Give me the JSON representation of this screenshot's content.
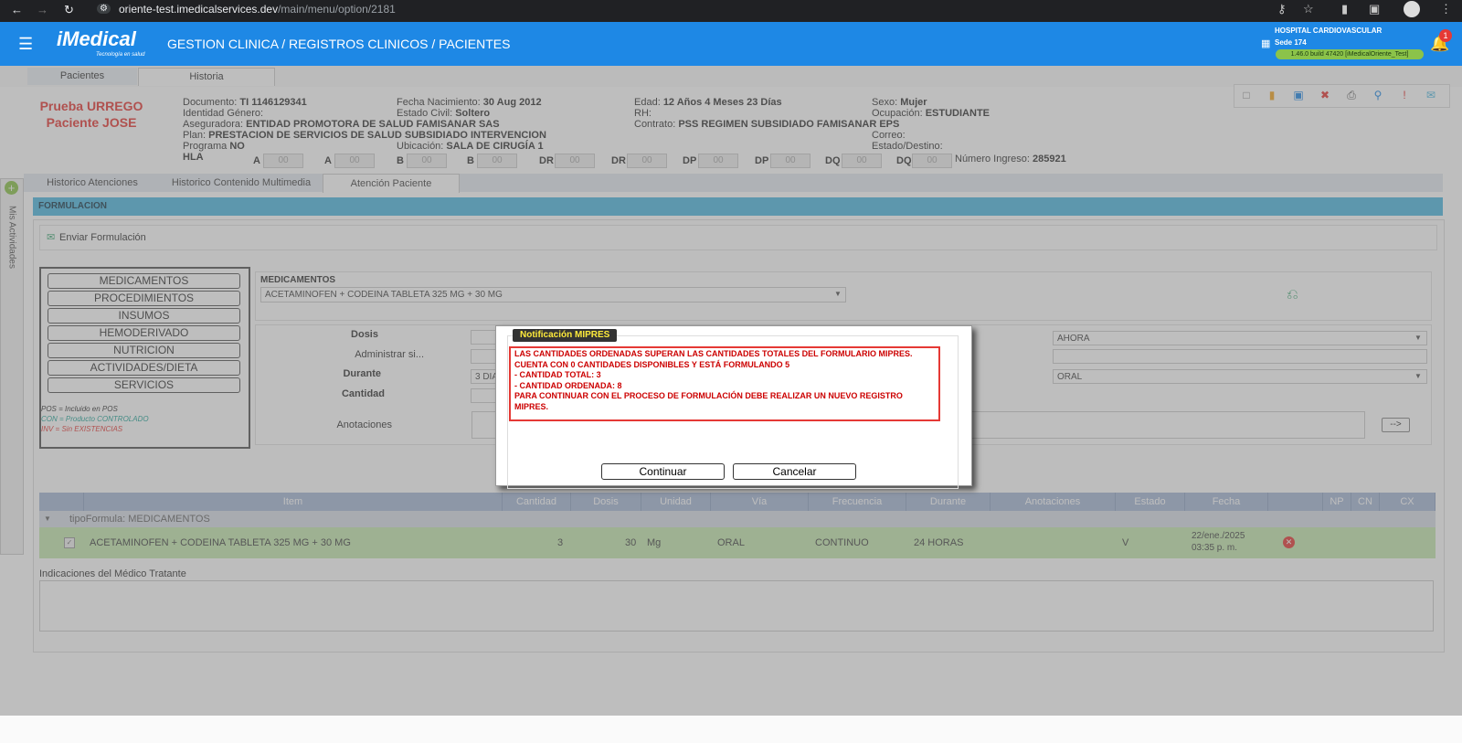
{
  "browser": {
    "url_host": "oriente-test.imedicalservices.dev",
    "url_path": "/main/menu/option/2181"
  },
  "header": {
    "logo": "iMedical",
    "logo_tagline": "Tecnología en salud",
    "breadcrumb": "GESTION CLINICA  /  REGISTROS CLINICOS  /  PACIENTES",
    "hospital": "HOSPITAL CARDIOVASCULAR",
    "sede": "Sede 174",
    "build": "1.46.0 build 47420 [iMedicalOriente_Test]",
    "notifications": "1"
  },
  "main_tabs": [
    "Pacientes",
    "Historia"
  ],
  "patient": {
    "name": "Prueba URREGO Paciente JOSE",
    "documento_label": "Documento:",
    "documento": "TI 1146129341",
    "fecha_nac_label": "Fecha Nacimiento:",
    "fecha_nac": "30 Aug 2012",
    "edad_label": "Edad:",
    "edad": "12 Años 4 Meses 23 Días",
    "sexo_label": "Sexo:",
    "sexo": "Mujer",
    "identidad_label": "Identidad Género:",
    "estado_civil_label": "Estado Civil:",
    "estado_civil": "Soltero",
    "rh_label": "RH:",
    "ocupacion_label": "Ocupación:",
    "ocupacion": "ESTUDIANTE",
    "aseguradora_label": "Aseguradora:",
    "aseguradora": "ENTIDAD PROMOTORA DE SALUD FAMISANAR SAS",
    "contrato_label": "Contrato:",
    "contrato": "PSS REGIMEN SUBSIDIADO FAMISANAR EPS",
    "plan_label": "Plan:",
    "plan": "PRESTACION DE SERVICIOS DE SALUD SUBSIDIADO INTERVENCION",
    "correo_label": "Correo:",
    "programa_label": "Programa",
    "programa": "NO",
    "ubicacion_label": "Ubicación:",
    "ubicacion": "SALA DE CIRUGÍA 1",
    "estado_destino_label": "Estado/Destino:",
    "hla_label": "HLA",
    "hla": [
      {
        "label": "A",
        "value": "00"
      },
      {
        "label": "A",
        "value": "00"
      },
      {
        "label": "B",
        "value": "00"
      },
      {
        "label": "B",
        "value": "00"
      },
      {
        "label": "DR",
        "value": "00"
      },
      {
        "label": "DR",
        "value": "00"
      },
      {
        "label": "DP",
        "value": "00"
      },
      {
        "label": "DP",
        "value": "00"
      },
      {
        "label": "DQ",
        "value": "00"
      },
      {
        "label": "DQ",
        "value": "00"
      }
    ],
    "ingreso_label": "Número Ingreso:",
    "ingreso": "285921"
  },
  "side_panel": "Mis Actividades",
  "sub_tabs": [
    "Historico Atenciones",
    "Historico Contenido Multimedia",
    "Atención Paciente"
  ],
  "formulacion": {
    "header": "FORMULACION",
    "send_label": "Enviar Formulación",
    "categories": [
      "MEDICAMENTOS",
      "PROCEDIMIENTOS",
      "INSUMOS",
      "HEMODERIVADO",
      "NUTRICION",
      "ACTIVIDADES/DIETA",
      "SERVICIOS"
    ],
    "legend": [
      {
        "text": "POS = Incluido en POS",
        "color": "#333333"
      },
      {
        "text": "CON = Producto CONTROLADO",
        "color": "#26a69a"
      },
      {
        "text": "INV = Sin EXISTENCIAS",
        "color": "#e53935"
      }
    ],
    "med_label": "MEDICAMENTOS",
    "med_value": "ACETAMINOFEN + CODEINA TABLETA 325 MG + 30 MG",
    "dosis_label": "Dosis",
    "administrar_label": "Administrar si...",
    "durante_label": "Durante",
    "durante_value": "3 DIA",
    "cantidad_label": "Cantidad",
    "anotaciones_label": "Anotaciones",
    "frecuencia_value": "AHORA",
    "via_value": "ORAL",
    "arrow_label": "-->"
  },
  "table": {
    "columns": [
      "Item",
      "Cantidad",
      "Dosis",
      "Unidad",
      "Vía",
      "Frecuencia",
      "Durante",
      "Anotaciones",
      "Estado",
      "Fecha",
      "",
      "NP",
      "CN",
      "CX"
    ],
    "group_label": "tipoFormula: MEDICAMENTOS",
    "rows": [
      {
        "item": "ACETAMINOFEN + CODEINA TABLETA 325 MG + 30 MG",
        "cantidad": "3",
        "dosis": "30",
        "unidad": "Mg",
        "via": "ORAL",
        "frecuencia": "CONTINUO",
        "durante": "24 HORAS",
        "anotaciones": "",
        "estado": "V",
        "fecha1": "22/ene./2025",
        "fecha2": "03:35 p. m."
      }
    ]
  },
  "indicaciones_label": "Indicaciones del Médico Tratante",
  "dialog": {
    "title": "Notificación MIPRES",
    "lines": [
      "LAS CANTIDADES ORDENADAS SUPERAN LAS CANTIDADES TOTALES DEL FORMULARIO MIPRES.",
      "CUENTA CON 0 CANTIDADES DISPONIBLES Y ESTÁ FORMULANDO 5",
      "- CANTIDAD TOTAL: 3",
      "- CANTIDAD ORDENADA: 8",
      "PARA CONTINUAR CON EL PROCESO DE FORMULACIÓN DEBE REALIZAR UN NUEVO REGISTRO MIPRES."
    ],
    "continue_label": "Continuar",
    "cancel_label": "Cancelar"
  },
  "colors": {
    "header_blue": "#1e88e5",
    "form_header": "#4fb9e0",
    "row_green": "#c5e8b0",
    "table_header": "#a7b8d6",
    "alert_red": "#e53935"
  }
}
